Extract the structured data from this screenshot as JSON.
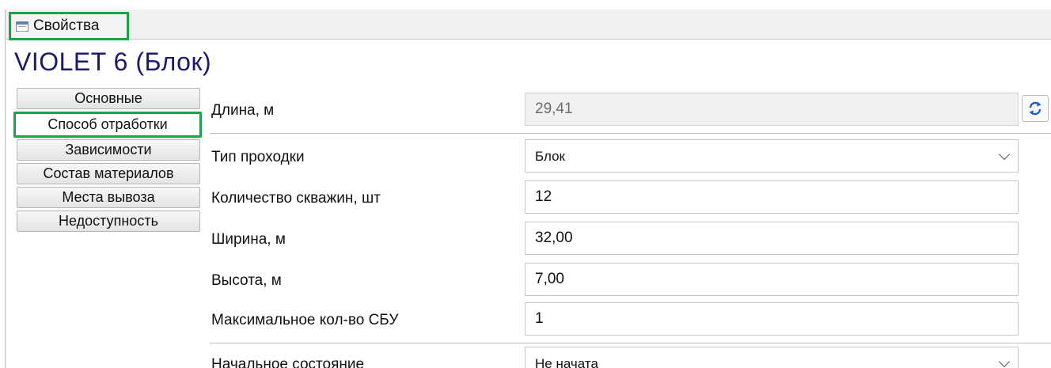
{
  "window": {
    "tab_title": "Свойства",
    "tab_icon": "properties-table-icon"
  },
  "object_title": "VIOLET 6 (Блок)",
  "nav": {
    "items": [
      {
        "label": "Основные",
        "active": false
      },
      {
        "label": "Способ отработки",
        "active": true
      },
      {
        "label": "Зависимости",
        "active": false
      },
      {
        "label": "Состав материалов",
        "active": false
      },
      {
        "label": "Места вывоза",
        "active": false
      },
      {
        "label": "Недоступность",
        "active": false
      }
    ]
  },
  "properties": {
    "length": {
      "label": "Длина, м",
      "value": "29,41"
    },
    "drift_type": {
      "label": "Тип проходки",
      "value": "Блок"
    },
    "wells_count": {
      "label": "Количество скважин, шт",
      "value": "12"
    },
    "width": {
      "label": "Ширина, м",
      "value": "32,00"
    },
    "height": {
      "label": "Высота, м",
      "value": "7,00"
    },
    "max_rigs": {
      "label": "Максимальное кол-во СБУ",
      "value": "1"
    },
    "initial_state": {
      "label": "Начальное состояние",
      "value": "Не начата"
    }
  },
  "icons": {
    "refresh": "refresh-arrows-icon",
    "dropdown": "chevron-down-icon"
  },
  "colors": {
    "highlight": "#1aa44a",
    "title": "#1a1a6e",
    "refresh_arrows": "#1e5bd6"
  }
}
